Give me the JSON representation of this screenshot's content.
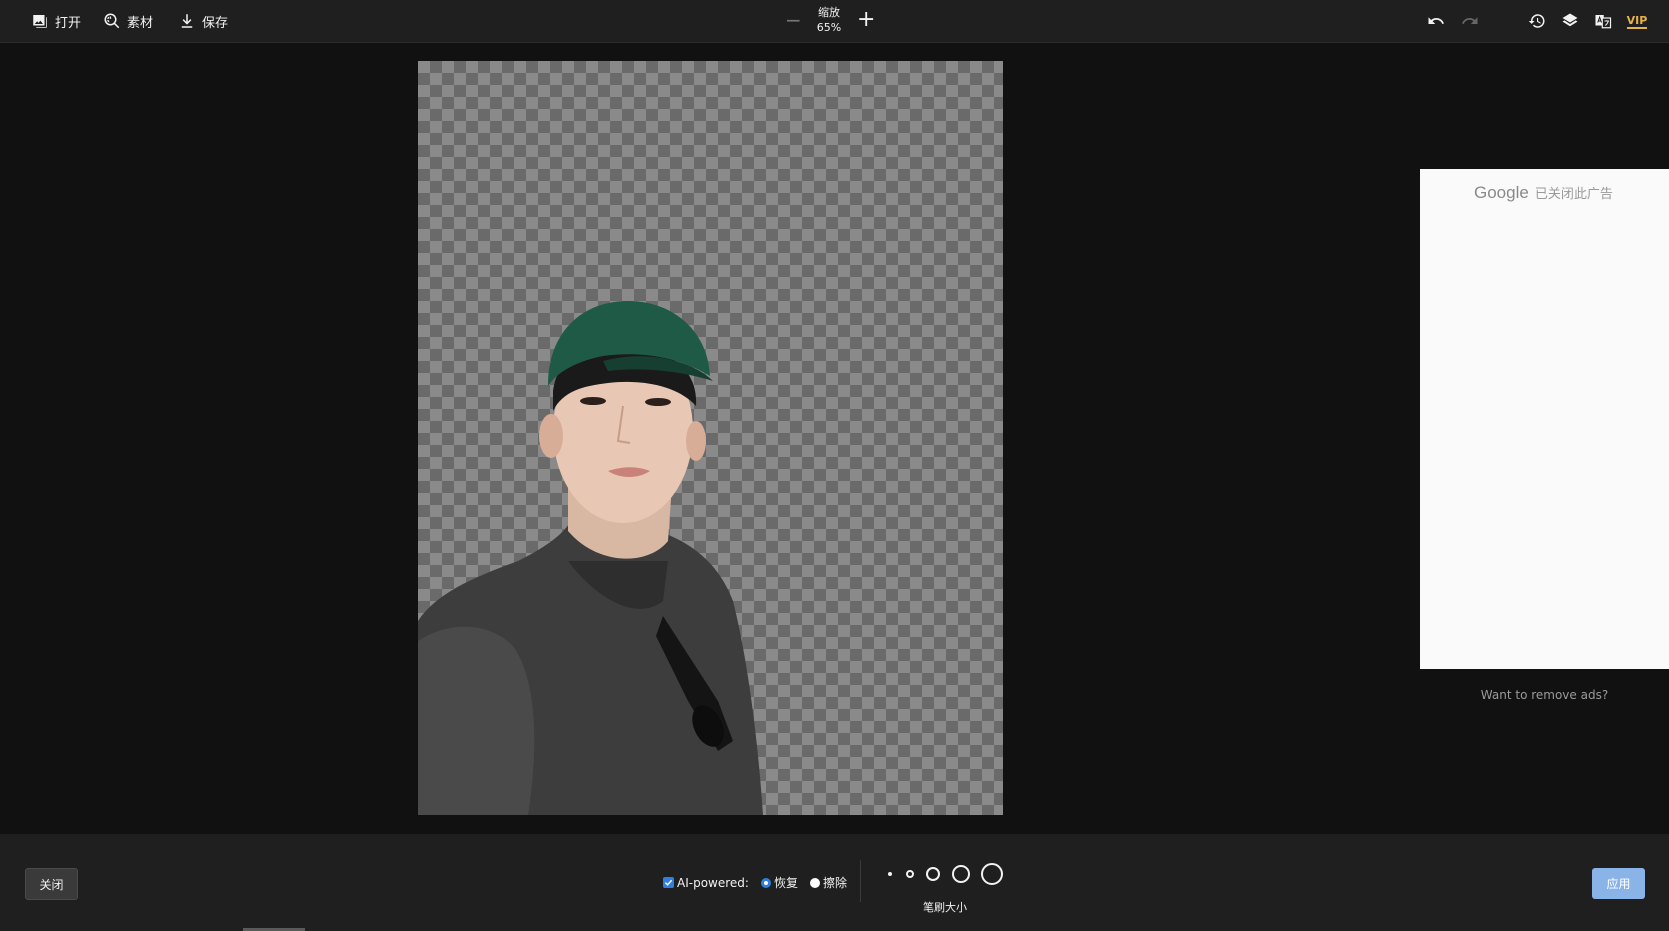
{
  "toolbar": {
    "open_label": "打开",
    "material_label": "素材",
    "save_label": "保存",
    "zoom_label": "缩放",
    "zoom_value": "65%",
    "vip_label": "VIP"
  },
  "ad": {
    "google_label": "Google",
    "closed_label": "已关闭此广告",
    "remove_ads": "Want to remove ads?"
  },
  "bottom": {
    "close_label": "关闭",
    "ai_label": "AI-powered:",
    "restore_label": "恢复",
    "erase_label": "擦除",
    "brush_size_label": "笔刷大小",
    "apply_label": "应用"
  },
  "colors": {
    "accent": "#2f7fe0",
    "apply": "#8ab4e8",
    "vip": "#e6b24b"
  }
}
